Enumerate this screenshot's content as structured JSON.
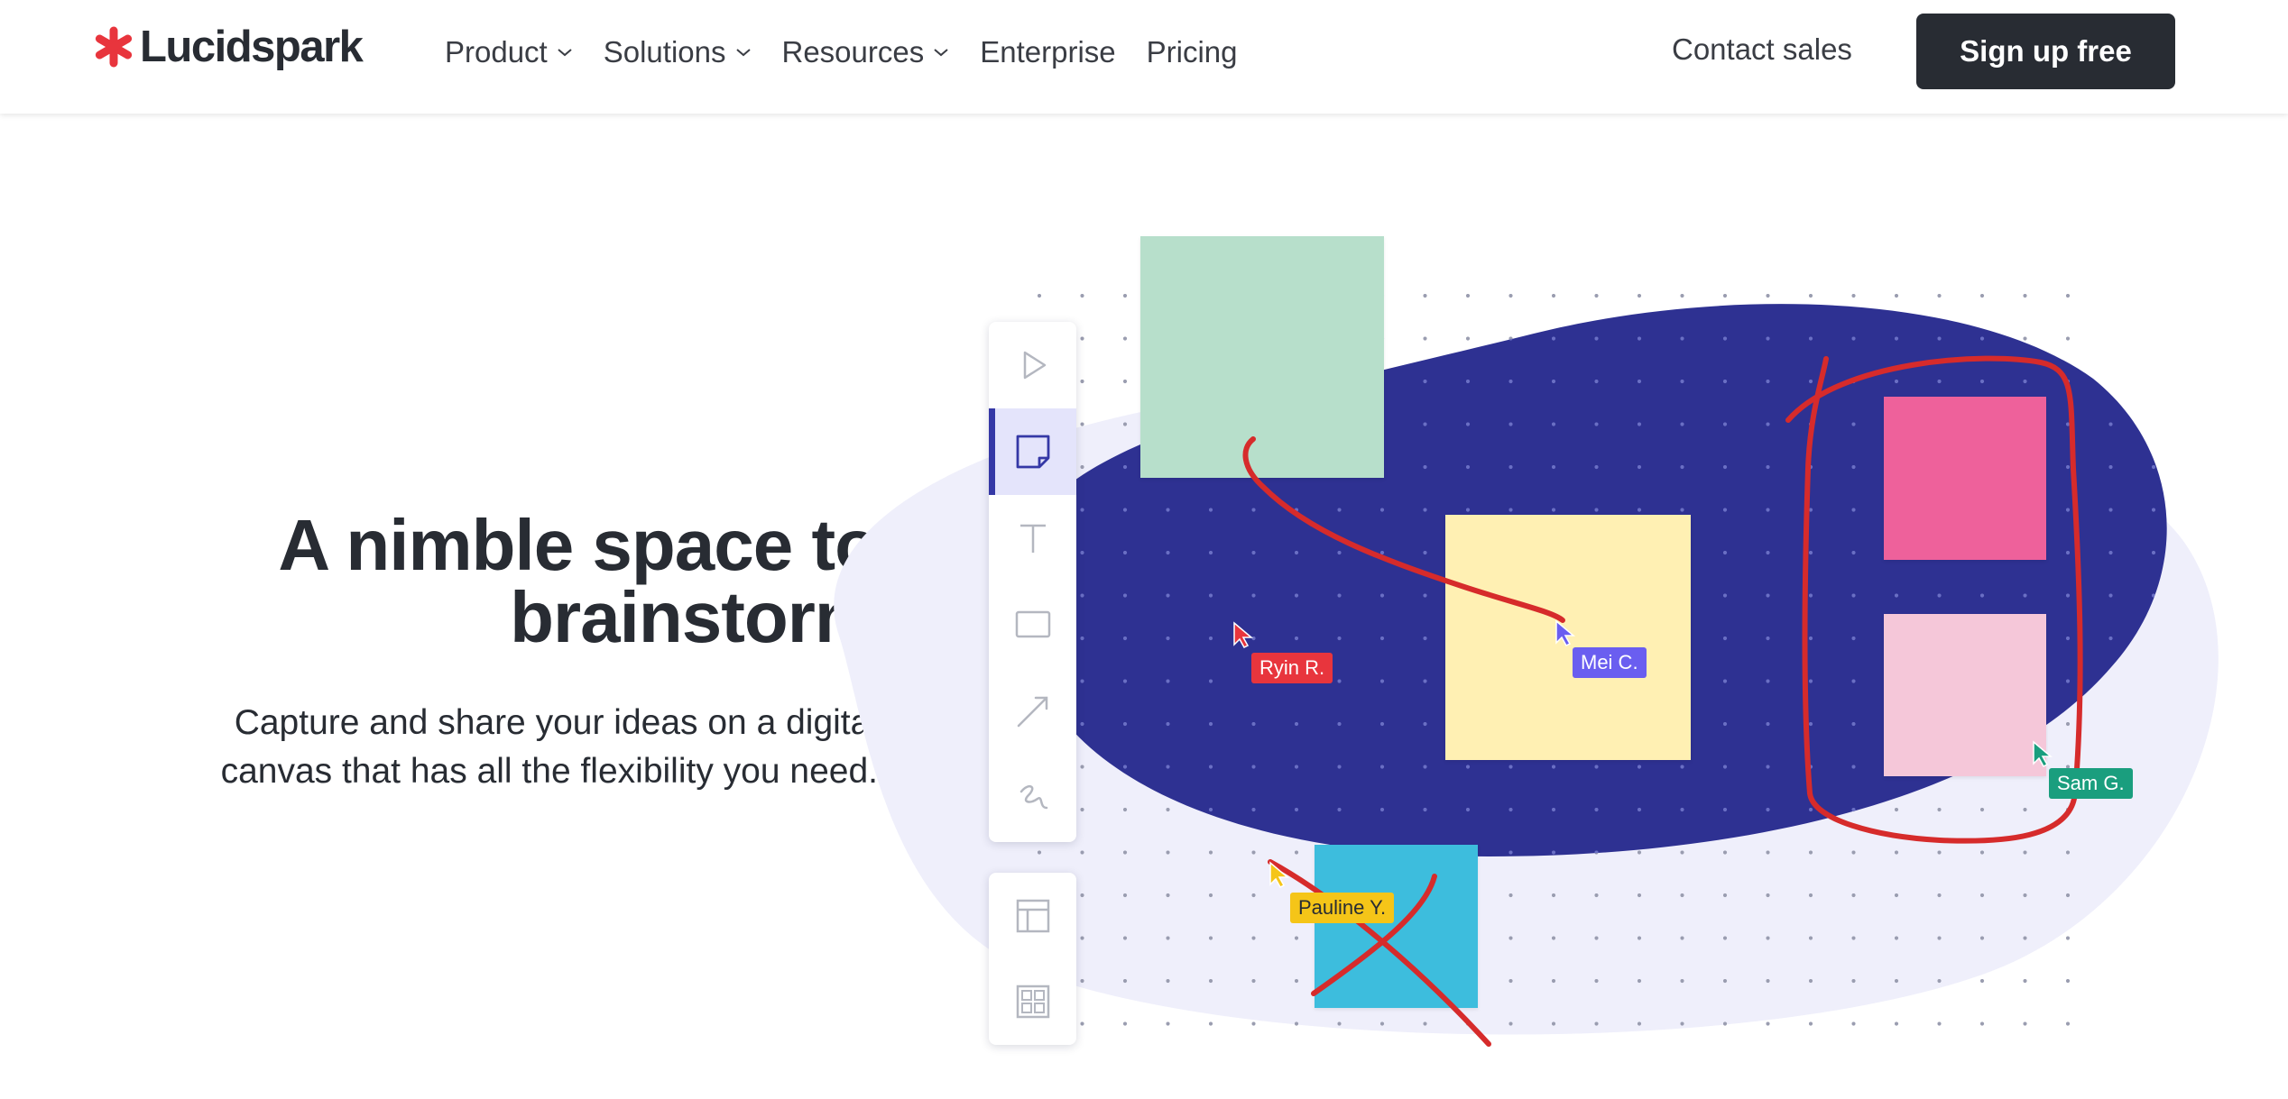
{
  "header": {
    "logo_text": "Lucidspark",
    "logo_icon": "asterisk-logo-icon",
    "nav": [
      {
        "label": "Product",
        "dropdown": true
      },
      {
        "label": "Solutions",
        "dropdown": true
      },
      {
        "label": "Resources",
        "dropdown": true
      },
      {
        "label": "Enterprise",
        "dropdown": false
      },
      {
        "label": "Pricing",
        "dropdown": false
      }
    ],
    "contact_sales": "Contact sales",
    "signup": "Sign up free"
  },
  "hero": {
    "title_line1": "A nimble space to",
    "title_line2": "brainstorm",
    "subtitle_line1": "Capture and share your ideas on a digital",
    "subtitle_line2": "canvas that has all the flexibility you need."
  },
  "illustration": {
    "toolbar": [
      {
        "icon": "pointer-icon",
        "active": false
      },
      {
        "icon": "sticky-note-icon",
        "active": true
      },
      {
        "icon": "text-icon",
        "active": false
      },
      {
        "icon": "rectangle-icon",
        "active": false
      },
      {
        "icon": "line-arrow-icon",
        "active": false
      },
      {
        "icon": "freehand-draw-icon",
        "active": false
      }
    ],
    "toolbar_secondary": [
      {
        "icon": "template-layout-icon"
      },
      {
        "icon": "grid-icon"
      }
    ],
    "collaborators": [
      {
        "name": "Ryin R.",
        "color": "#e8353d"
      },
      {
        "name": "Mei C.",
        "color": "#6a5ef0"
      },
      {
        "name": "Sam G.",
        "color": "#1a9e7e"
      },
      {
        "name": "Pauline Y.",
        "color": "#f5c518"
      }
    ],
    "colors": {
      "blob": "#2e3192",
      "blob_light": "#efeffb",
      "note_green": "#b7dfcb",
      "note_yellow": "#fff0b3",
      "note_pink": "#ee619b",
      "note_light_pink": "#f5c7d9",
      "note_blue": "#3dbddd",
      "pen_red": "#d62b2b"
    }
  }
}
